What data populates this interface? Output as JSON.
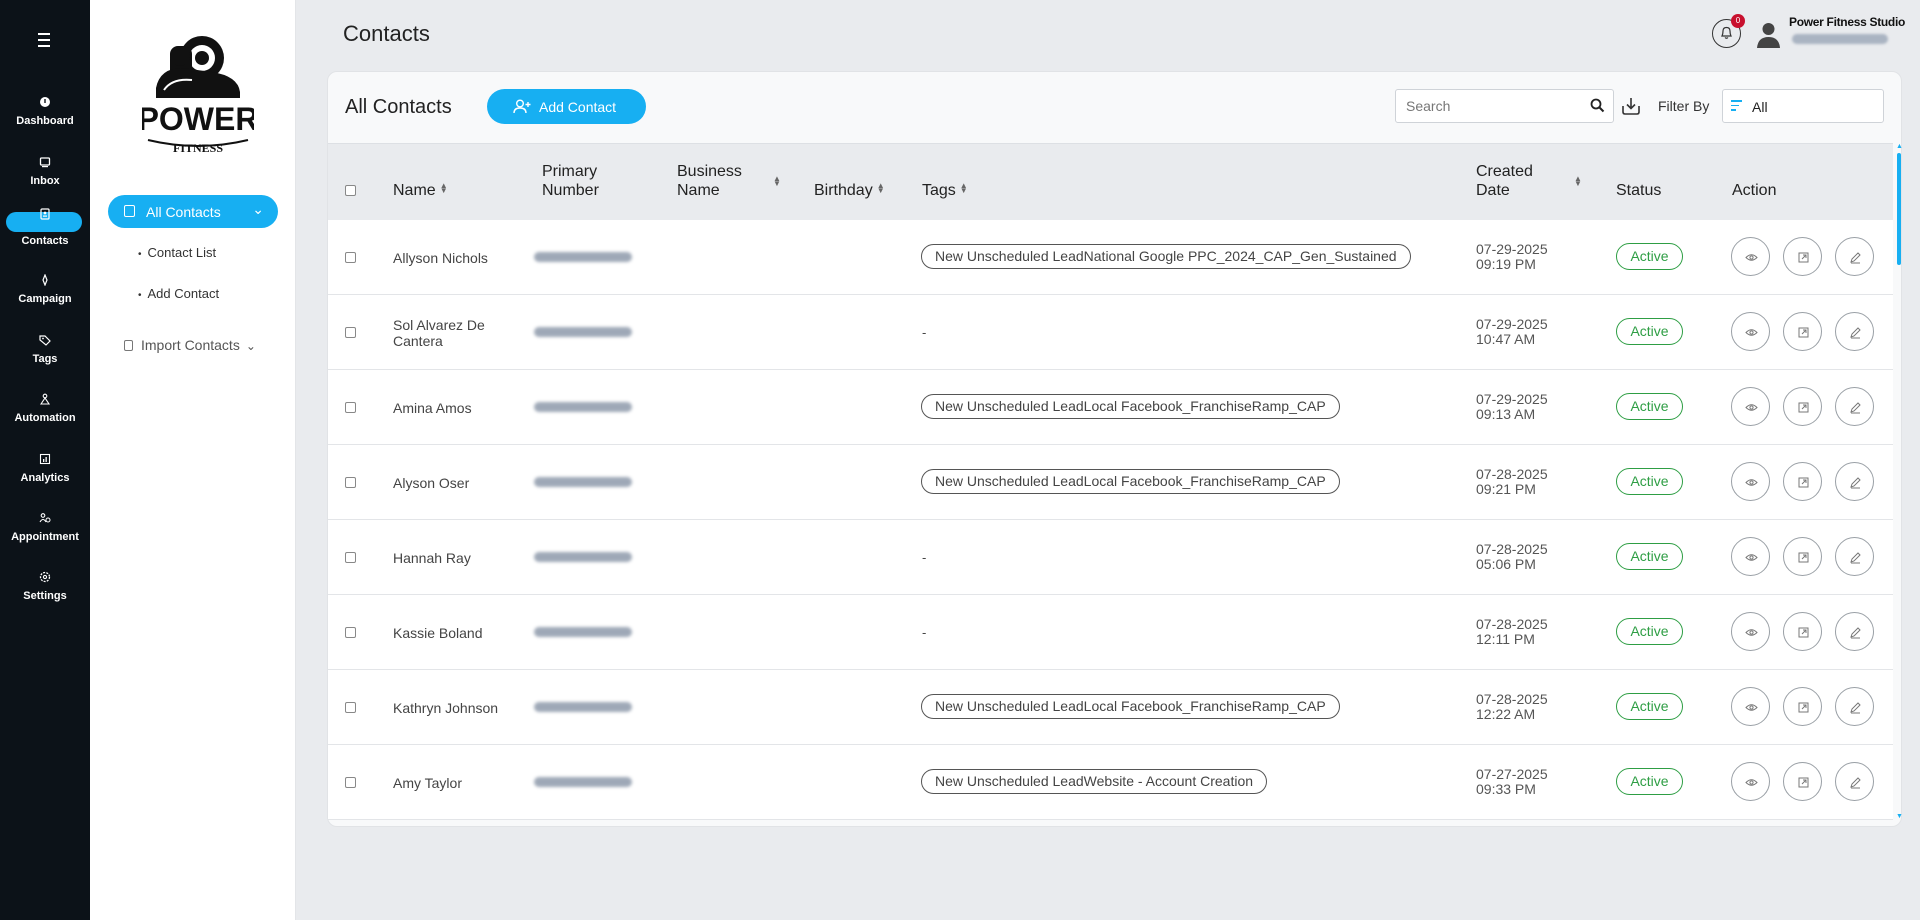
{
  "nav": {
    "items": [
      {
        "label": "Dashboard",
        "icon": "dashboard-icon"
      },
      {
        "label": "Inbox",
        "icon": "inbox-icon"
      },
      {
        "label": "Contacts",
        "icon": "contacts-icon"
      },
      {
        "label": "Campaign",
        "icon": "campaign-icon"
      },
      {
        "label": "Tags",
        "icon": "tag-icon"
      },
      {
        "label": "Automation",
        "icon": "automation-icon"
      },
      {
        "label": "Analytics",
        "icon": "analytics-icon"
      },
      {
        "label": "Appointment",
        "icon": "appointment-icon"
      },
      {
        "label": "Settings",
        "icon": "settings-icon"
      }
    ],
    "active": "Contacts"
  },
  "brand": {
    "logo_text_1": "POWER",
    "logo_text_2": "FITNESS"
  },
  "subnav": {
    "all_contacts": "All Contacts",
    "contact_list": "Contact List",
    "add_contact": "Add Contact",
    "import_contacts": "Import Contacts"
  },
  "header": {
    "title": "Contacts",
    "notifications": "0",
    "user_name": "Power Fitness Studio"
  },
  "card": {
    "title": "All Contacts",
    "add_button": "Add Contact",
    "search_placeholder": "Search",
    "filter_label": "Filter By",
    "filter_value": "All"
  },
  "table": {
    "columns": {
      "name": "Name",
      "primary_1": "Primary",
      "primary_2": "Number",
      "business_1": "Business",
      "business_2": "Name",
      "birthday": "Birthday",
      "tags": "Tags",
      "created_1": "Created",
      "created_2": "Date",
      "status": "Status",
      "action": "Action"
    },
    "rows": [
      {
        "name1": "Allyson Nichols",
        "name2": "",
        "tag": "New Unscheduled LeadNational Google PPC_2024_CAP_Gen_Sustained",
        "date": "07-29-2025",
        "time": "09:19 PM",
        "status": "Active"
      },
      {
        "name1": "Sol Alvarez De",
        "name2": "Cantera",
        "tag": "-",
        "date": "07-29-2025",
        "time": "10:47 AM",
        "status": "Active"
      },
      {
        "name1": "Amina Amos",
        "name2": "",
        "tag": "New Unscheduled LeadLocal Facebook_FranchiseRamp_CAP",
        "date": "07-29-2025",
        "time": "09:13 AM",
        "status": "Active"
      },
      {
        "name1": "Alyson Oser",
        "name2": "",
        "tag": "New Unscheduled LeadLocal Facebook_FranchiseRamp_CAP",
        "date": "07-28-2025",
        "time": "09:21 PM",
        "status": "Active"
      },
      {
        "name1": "Hannah Ray",
        "name2": "",
        "tag": "-",
        "date": "07-28-2025",
        "time": "05:06 PM",
        "status": "Active"
      },
      {
        "name1": "Kassie Boland",
        "name2": "",
        "tag": "-",
        "date": "07-28-2025",
        "time": "12:11 PM",
        "status": "Active"
      },
      {
        "name1": "Kathryn Johnson",
        "name2": "",
        "tag": "New Unscheduled LeadLocal Facebook_FranchiseRamp_CAP",
        "date": "07-28-2025",
        "time": "12:22 AM",
        "status": "Active"
      },
      {
        "name1": "Amy Taylor",
        "name2": "",
        "tag": "New Unscheduled LeadWebsite - Account Creation",
        "date": "07-27-2025",
        "time": "09:33 PM",
        "status": "Active"
      }
    ]
  },
  "colors": {
    "accent": "#17aff2",
    "nav_bg": "#0c1218",
    "status_active": "#2e9e44",
    "badge": "#c8102e"
  }
}
